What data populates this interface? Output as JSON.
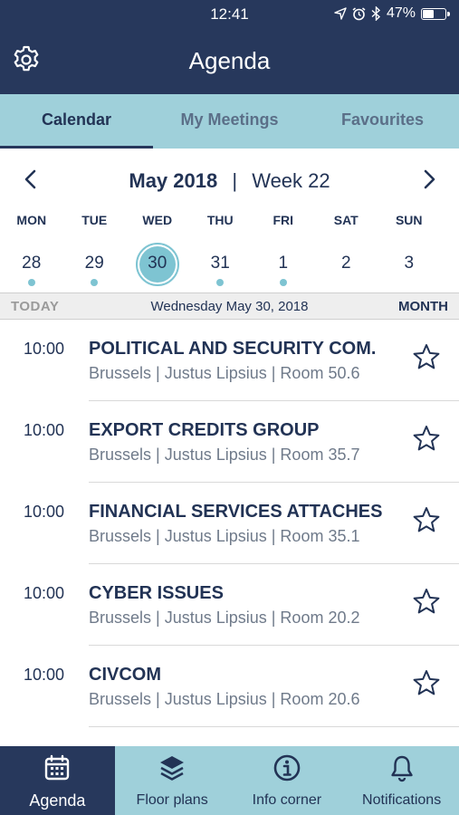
{
  "status": {
    "time": "12:41",
    "battery": "47%",
    "battery_level": 0.47
  },
  "header": {
    "title": "Agenda",
    "settings_icon": "gear-icon"
  },
  "tabs": [
    {
      "label": "Calendar",
      "active": true
    },
    {
      "label": "My Meetings",
      "active": false
    },
    {
      "label": "Favourites",
      "active": false
    }
  ],
  "calendar": {
    "month": "May 2018",
    "separator": "|",
    "week": "Week 22",
    "days": [
      "MON",
      "TUE",
      "WED",
      "THU",
      "FRI",
      "SAT",
      "SUN"
    ],
    "dates": [
      {
        "num": "28",
        "has_event": true,
        "selected": false
      },
      {
        "num": "29",
        "has_event": true,
        "selected": false
      },
      {
        "num": "30",
        "has_event": false,
        "selected": true
      },
      {
        "num": "31",
        "has_event": true,
        "selected": false
      },
      {
        "num": "1",
        "has_event": true,
        "selected": false
      },
      {
        "num": "2",
        "has_event": false,
        "selected": false
      },
      {
        "num": "3",
        "has_event": false,
        "selected": false
      }
    ],
    "today_label": "TODAY",
    "selected_date": "Wednesday May 30, 2018",
    "month_label": "MONTH"
  },
  "meetings": [
    {
      "time": "10:00",
      "name": "POLITICAL AND SECURITY COM.",
      "location": "Brussels | Justus Lipsius | Room 50.6"
    },
    {
      "time": "10:00",
      "name": "EXPORT CREDITS GROUP",
      "location": "Brussels | Justus Lipsius | Room 35.7"
    },
    {
      "time": "10:00",
      "name": "FINANCIAL SERVICES ATTACHES",
      "location": "Brussels | Justus Lipsius | Room 35.1"
    },
    {
      "time": "10:00",
      "name": "CYBER ISSUES",
      "location": "Brussels | Justus Lipsius | Room 20.2"
    },
    {
      "time": "10:00",
      "name": "CIVCOM",
      "location": "Brussels | Justus Lipsius | Room 20.6"
    }
  ],
  "bottom_nav": [
    {
      "label": "Agenda",
      "icon": "calendar-icon",
      "active": true
    },
    {
      "label": "Floor plans",
      "icon": "layers-icon",
      "active": false
    },
    {
      "label": "Info corner",
      "icon": "info-icon",
      "active": false
    },
    {
      "label": "Notifications",
      "icon": "bell-icon",
      "active": false
    }
  ],
  "colors": {
    "navy": "#27385c",
    "teal_light": "#9fd0da",
    "accent_dot": "#7ec4d2"
  }
}
